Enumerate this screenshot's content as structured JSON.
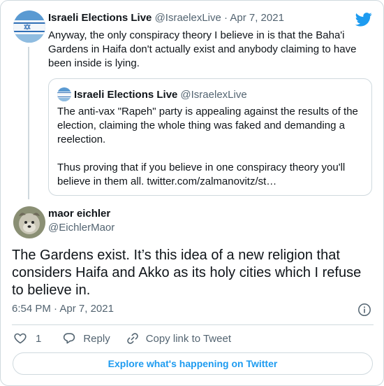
{
  "reply_tweet": {
    "author_name": "Israeli Elections Live",
    "handle": "@IsraelexLive",
    "separator": "·",
    "date": "Apr 7, 2021",
    "text": "Anyway, the only conspiracy theory I believe in is that the Baha'i Gardens in Haifa don't actually exist and anybody claiming to have been inside is lying."
  },
  "quoted_tweet": {
    "author_name": "Israeli Elections Live",
    "handle": "@IsraelexLive",
    "text": "The anti-vax \"Rapeh\" party is appealing against the results of the election, claiming the whole thing was faked and demanding a reelection.\n\nThus proving that if you believe in one conspiracy theory you'll believe in them all. twitter.com/zalmanovitz/st…"
  },
  "main_tweet": {
    "author_name": "maor eichler",
    "handle": "@EichlerMaor",
    "text": "The Gardens exist. It’s this idea of a new religion that considers Haifa and Akko as its holy cities which I refuse to believe in.",
    "time": "6:54 PM",
    "separator": "·",
    "date": "Apr 7, 2021"
  },
  "actions": {
    "like_count": "1",
    "reply_label": "Reply",
    "copy_link_label": "Copy link to Tweet"
  },
  "explore_label": "Explore what's happening on Twitter",
  "icons": {
    "brand": "twitter-bird-icon",
    "like": "heart-outline-icon",
    "reply": "speech-bubble-icon",
    "copy_link": "link-icon",
    "info": "info-circle-icon"
  },
  "colors": {
    "accent": "#1d9bf0",
    "text": "#0f1419",
    "muted": "#536471",
    "border": "#cfd9de"
  }
}
